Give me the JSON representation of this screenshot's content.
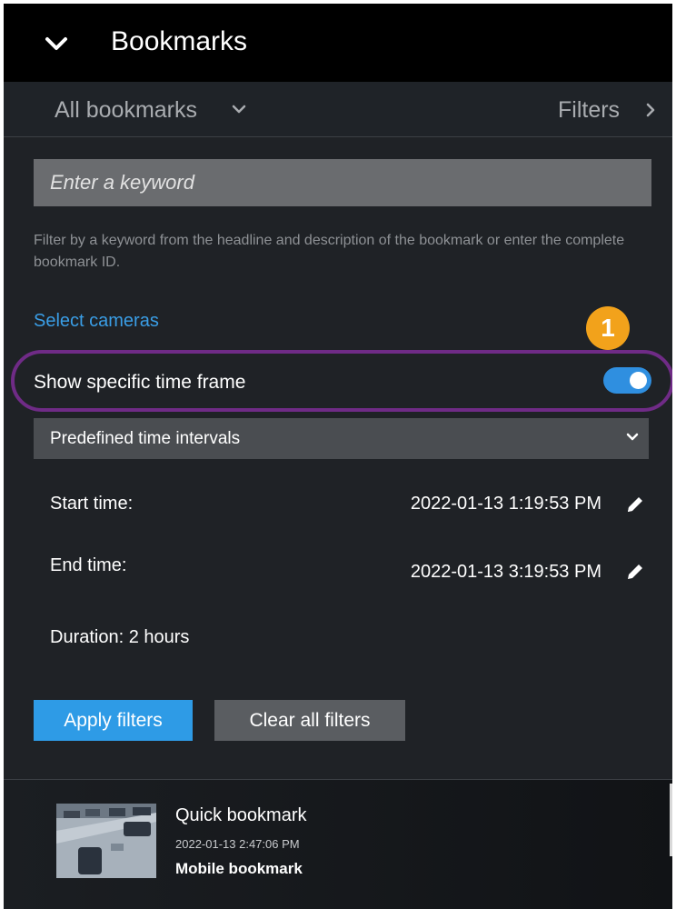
{
  "header": {
    "title": "Bookmarks",
    "collapse_icon": "chevron-down-icon"
  },
  "subheader": {
    "scope_label": "All bookmarks",
    "filters_label": "Filters"
  },
  "search": {
    "placeholder": "Enter a keyword",
    "hint": "Filter by a keyword from the headline and description of the bookmark or enter the complete bookmark ID."
  },
  "select_cameras_label": "Select cameras",
  "time_frame": {
    "label": "Show specific time frame",
    "enabled": true
  },
  "callout_number": "1",
  "dropdown": {
    "selected": "Predefined time intervals"
  },
  "times": {
    "start_label": "Start time:",
    "start_value": "2022-01-13 1:19:53 PM",
    "end_label": "End time:",
    "end_value": "2022-01-13 3:19:53 PM",
    "duration": "Duration: 2 hours"
  },
  "buttons": {
    "apply": "Apply filters",
    "clear": "Clear all filters"
  },
  "results": [
    {
      "title": "Quick bookmark",
      "timestamp": "2022-01-13 2:47:06 PM",
      "subtitle": "Mobile bookmark"
    }
  ],
  "colors": {
    "accent": "#2e9be6",
    "link": "#3a9ee6",
    "highlight_ring": "#6f2b86",
    "badge": "#f2a21b"
  }
}
